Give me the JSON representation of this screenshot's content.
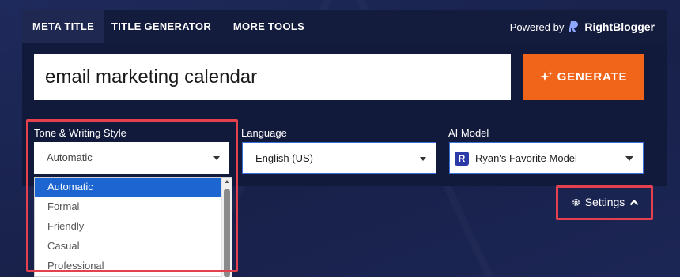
{
  "tabs": [
    {
      "label": "META TITLE",
      "active": true
    },
    {
      "label": "TITLE GENERATOR",
      "active": false
    },
    {
      "label": "MORE TOOLS",
      "active": false
    }
  ],
  "powered": {
    "prefix": "Powered by",
    "brand": "RightBlogger"
  },
  "search": {
    "value": "email marketing calendar"
  },
  "generate": {
    "label": "GENERATE",
    "icon": "sparkle-icon"
  },
  "fields": {
    "tone": {
      "label": "Tone & Writing Style",
      "value": "Automatic"
    },
    "language": {
      "label": "Language",
      "value": "English (US)"
    },
    "ai_model": {
      "label": "AI Model",
      "value": "Ryan's Favorite Model",
      "icon_letter": "R"
    }
  },
  "dropdown": {
    "options": [
      "Automatic",
      "Formal",
      "Friendly",
      "Casual",
      "Professional"
    ],
    "selected": "Automatic"
  },
  "settings": {
    "label": "Settings"
  },
  "colors": {
    "accent": "#f06519",
    "highlight": "#e5404e",
    "selection": "#1d66d1",
    "background": "#1b2452"
  }
}
